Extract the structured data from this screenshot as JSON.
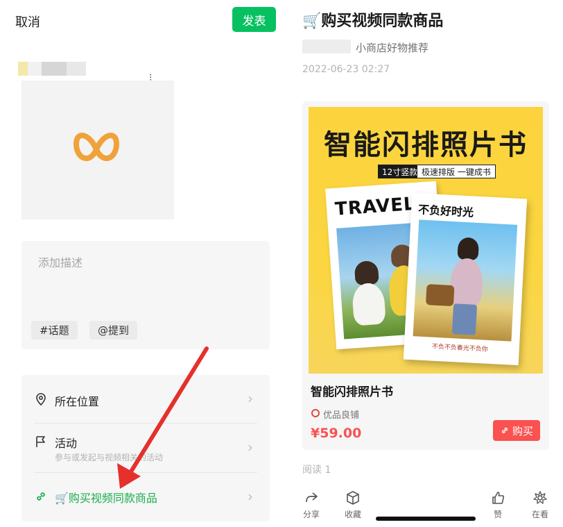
{
  "left": {
    "header": {
      "cancel_label": "取消",
      "publish_label": "发表"
    },
    "composer": {
      "description_placeholder": "添加描述",
      "topic_chip": "#话题",
      "mention_chip": "@提到"
    },
    "options": [
      {
        "label": "所在位置",
        "icon": "location-pin-icon"
      },
      {
        "label": "活动",
        "sublabel": "参与或发起与视频相关的活动",
        "icon": "flag-icon"
      },
      {
        "label": "🛒购买视频同款商品",
        "icon": "link-icon"
      }
    ],
    "accent_color": "#07c160",
    "annotation_arrow_color": "#e5302b"
  },
  "right": {
    "title": "🛒购买视频同款商品",
    "author": "小商店好物推荐",
    "date": "2022-06-23 02:27",
    "product": {
      "image_headline": "智能闪排照片书",
      "image_tag_1": "12寸竖款",
      "image_tag_2": "极速排版 一键成书",
      "book1_title": "TRAVEL",
      "book2_title": "不负好时光",
      "book2_footer": "不负不负春光不负你",
      "name": "智能闪排照片书",
      "shop": "优品良铺",
      "price": "¥59.00",
      "buy_label": "购买",
      "price_color": "#fa5151"
    },
    "reads": "阅读 1",
    "bottom_bar": [
      {
        "label": "分享",
        "icon": "share-icon"
      },
      {
        "label": "收藏",
        "icon": "box-icon"
      },
      {
        "label": "赞",
        "icon": "thumbs-up-icon"
      },
      {
        "label": "在看",
        "icon": "flower-icon"
      }
    ]
  }
}
